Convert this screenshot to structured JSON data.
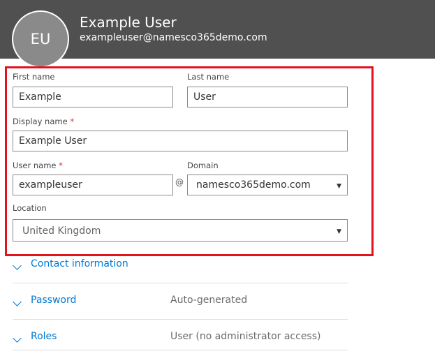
{
  "header": {
    "avatar_initials": "EU",
    "user_name": "Example User",
    "user_email": "exampleuser@namesco365demo.com"
  },
  "form": {
    "first_name": {
      "label": "First name",
      "value": "Example"
    },
    "last_name": {
      "label": "Last name",
      "value": "User"
    },
    "display_name": {
      "label": "Display name",
      "required_mark": "*",
      "value": "Example User"
    },
    "user_name": {
      "label": "User name",
      "required_mark": "*",
      "value": "exampleuser"
    },
    "at_symbol": "@",
    "domain": {
      "label": "Domain",
      "value": "namesco365demo.com"
    },
    "location": {
      "label": "Location",
      "value": "United Kingdom"
    }
  },
  "sections": [
    {
      "title": "Contact information",
      "value": ""
    },
    {
      "title": "Password",
      "value": "Auto-generated"
    },
    {
      "title": "Roles",
      "value": "User (no administrator access)"
    }
  ],
  "icons": {
    "expand": "chevron-down-icon",
    "dropdown": "caret-down-icon"
  },
  "colors": {
    "header_bg": "#505050",
    "accent": "#0078d4",
    "highlight": "#e3121f",
    "required": "#d13438"
  }
}
